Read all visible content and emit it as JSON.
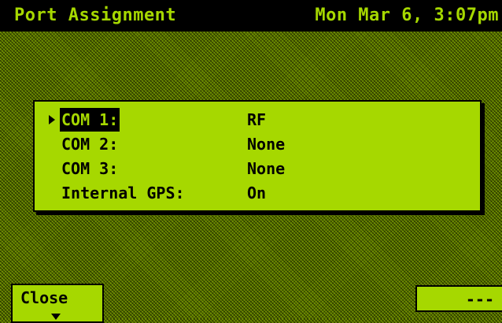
{
  "header": {
    "title": "Port Assignment",
    "datetime": "Mon Mar 6, 3:07pm"
  },
  "ports": [
    {
      "label": "COM 1:",
      "value": "RF",
      "selected": true
    },
    {
      "label": "COM 2:",
      "value": "None",
      "selected": false
    },
    {
      "label": "COM 3:",
      "value": "None",
      "selected": false
    },
    {
      "label": "Internal GPS:",
      "value": "On",
      "selected": false
    }
  ],
  "softkeys": {
    "left_label": "Close",
    "right_label": "---"
  },
  "colors": {
    "screen_green": "#a6d800",
    "background_green": "#6f8f00",
    "ink": "#000000"
  }
}
